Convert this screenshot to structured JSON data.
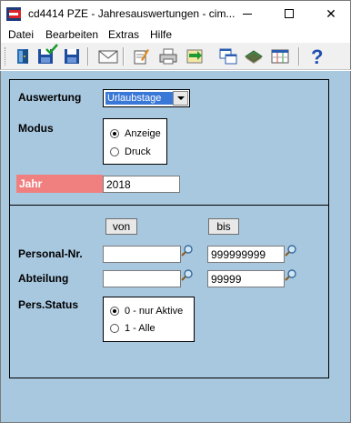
{
  "window": {
    "title": "cd4414 PZE - Jahresauswertungen - cim...",
    "minimize_symbol": "",
    "maximize_symbol": "",
    "close_symbol": "✕"
  },
  "menu": [
    "Datei",
    "Bearbeiten",
    "Extras",
    "Hilfe"
  ],
  "toolbar": {
    "icons": [
      "exit-door-icon",
      "save-icon",
      "save-check-icon",
      "save-as-icon",
      "mail-icon",
      "edit-document-icon",
      "print-icon",
      "transfer-icon",
      "windows-icon",
      "book-icon",
      "table-icon",
      "help-icon"
    ]
  },
  "form": {
    "auswertung_label": "Auswertung",
    "auswertung_value": "Urlaubstage",
    "modus_label": "Modus",
    "modus_options": [
      {
        "label": "Anzeige",
        "selected": true
      },
      {
        "label": "Druck",
        "selected": false
      }
    ],
    "jahr_label": "Jahr",
    "jahr_value": "2018",
    "jahr_label_bg": "#f08080",
    "von_label": "von",
    "bis_label": "bis",
    "personal_label": "Personal-Nr.",
    "personal_von": "",
    "personal_bis": "999999999",
    "abteilung_label": "Abteilung",
    "abteilung_von": "",
    "abteilung_bis": "99999",
    "status_label": "Pers.Status",
    "status_options": [
      {
        "label": "0 - nur Aktive",
        "selected": true
      },
      {
        "label": "1 - Alle",
        "selected": false
      }
    ]
  },
  "colors": {
    "client_bg": "#a8c8e0",
    "highlight": "#3a78d7",
    "jahr_label_bg": "#f08080"
  }
}
